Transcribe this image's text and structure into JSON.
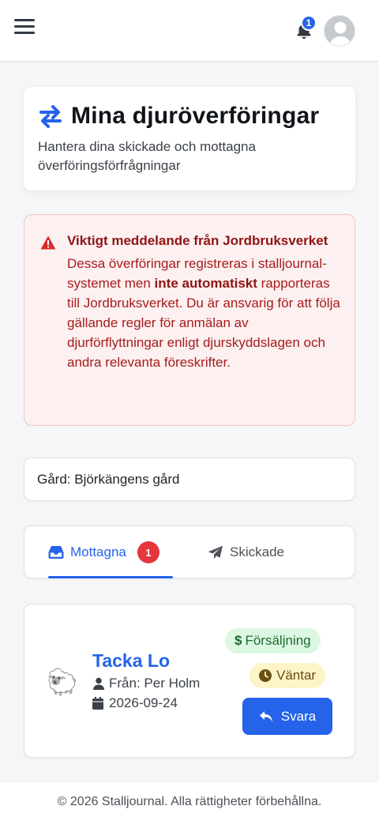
{
  "header": {
    "notification_count": "1"
  },
  "hero": {
    "title": "Mina djuröverföringar",
    "subtitle": "Hantera dina skickade och mottagna överföringsförfrågningar"
  },
  "alert": {
    "title": "Viktigt meddelande från Jordbruksverket",
    "body_part1": "Dessa överföringar registreras i stalljournal-systemet men ",
    "body_bold": "inte automatiskt",
    "body_part2": " rapporteras till Jordbruksverket. Du är ansvarig för att följa gällande regler för anmälan av djurförflyttningar enligt djurskyddslagen och andra relevanta föreskrifter."
  },
  "farm": {
    "label": "Gård: Björkängens gård"
  },
  "tabs": {
    "received_label": "Mottagna",
    "received_count": "1",
    "sent_label": "Skickade"
  },
  "transfer": {
    "animal_name": "Tacka Lo",
    "from": "Från: Per Holm",
    "date": "2026-09-24",
    "type_badge": "Försäljning",
    "status_badge": "Väntar",
    "reply_label": "Svara",
    "animal_emoji": "🐑"
  },
  "footer": {
    "text": "© 2026 Stalljournal. Alla rättigheter förbehållna."
  },
  "colors": {
    "accent": "#2563eb",
    "danger": "#e5363d",
    "alert_bg": "#fdf0f0",
    "sale_bg": "#dcf7e2",
    "wait_bg": "#fdf4c8"
  }
}
